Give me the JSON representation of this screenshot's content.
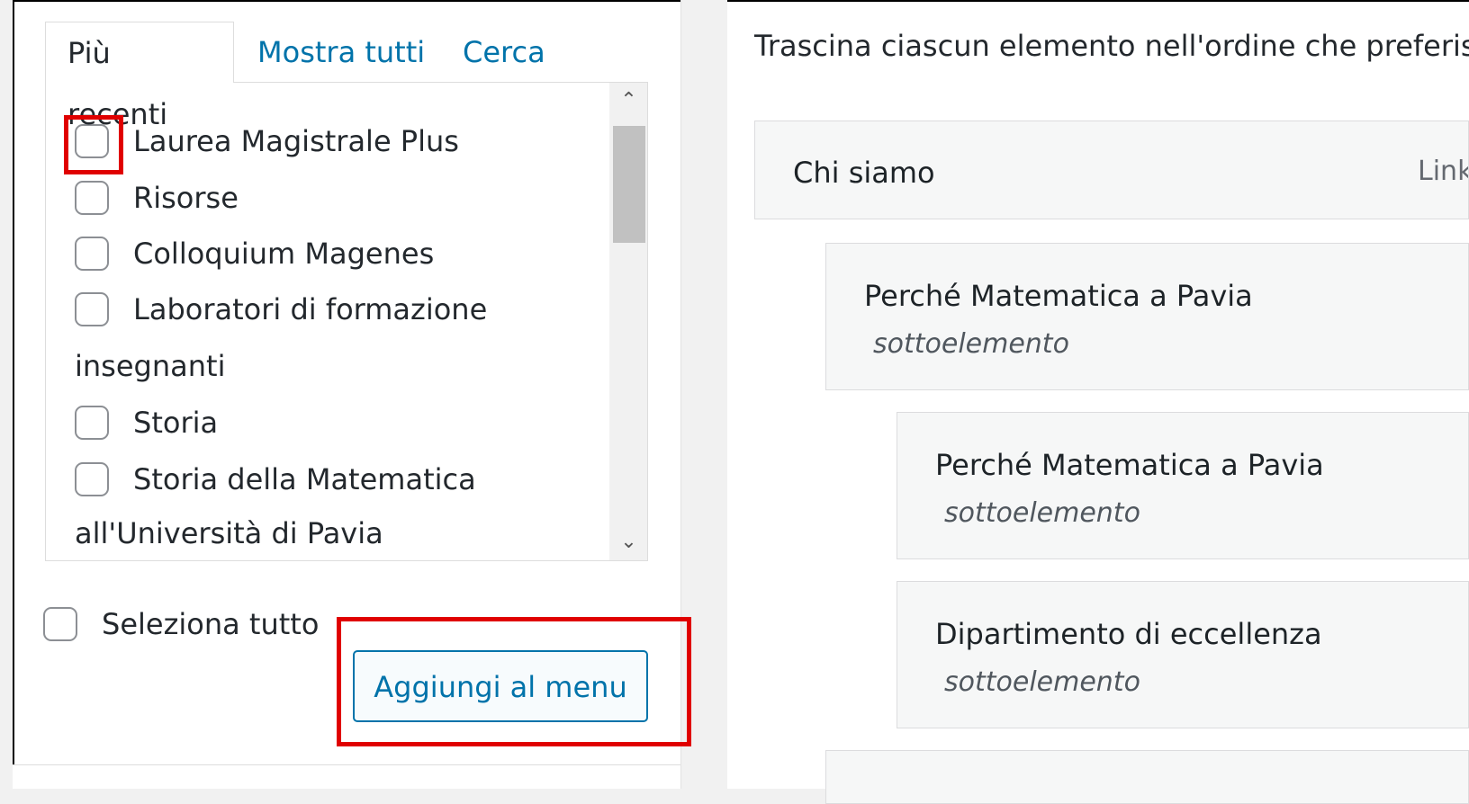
{
  "tabs": [
    {
      "label": "Più recenti",
      "active": true
    },
    {
      "label": "Mostra tutti",
      "active": false
    },
    {
      "label": "Cerca",
      "active": false
    }
  ],
  "pages_list": {
    "items": [
      {
        "label": "Laurea Magistrale Plus",
        "checked": false
      },
      {
        "label": "Risorse",
        "checked": false
      },
      {
        "label": "Colloquium Magenes",
        "checked": false
      },
      {
        "label": "Laboratori di formazione",
        "checked": false
      },
      {
        "label": "insegnanti",
        "continuation": true
      },
      {
        "label": "Storia",
        "checked": false
      },
      {
        "label": "Storia della Matematica",
        "checked": false
      },
      {
        "label": "all'Università di Pavia",
        "continuation": true
      }
    ]
  },
  "select_all_label": "Seleziona tutto",
  "add_to_menu_label": "Aggiungi al menu",
  "instructions": "Trascina ciascun elemento nell'ordine che preferisci",
  "menu_structure": [
    {
      "title": "Chi siamo",
      "type": "Link"
    },
    {
      "title": "Perché Matematica a Pavia",
      "sub": "sottoelemento"
    },
    {
      "title": "Perché Matematica a Pavia",
      "sub": "sottoelemento"
    },
    {
      "title": "Dipartimento di eccellenza",
      "sub": "sottoelemento"
    }
  ],
  "colors": {
    "link": "#0073aa",
    "highlight": "#e00000"
  }
}
